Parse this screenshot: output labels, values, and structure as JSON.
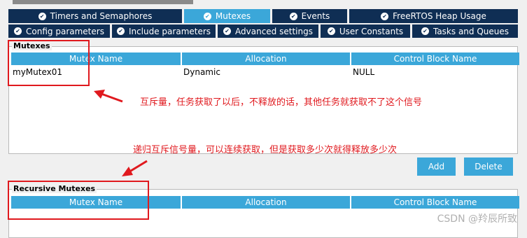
{
  "tabs_row1": [
    {
      "label": "Timers and Semaphores",
      "active": false
    },
    {
      "label": "Mutexes",
      "active": true
    },
    {
      "label": "Events",
      "active": false
    },
    {
      "label": "FreeRTOS Heap Usage",
      "active": false
    }
  ],
  "tabs_row2": [
    {
      "label": "Config parameters"
    },
    {
      "label": "Include parameters"
    },
    {
      "label": "Advanced settings"
    },
    {
      "label": "User Constants"
    },
    {
      "label": "Tasks and Queues"
    }
  ],
  "mutexes": {
    "section_title": "Mutexes",
    "columns": [
      "Mutex Name",
      "Allocation",
      "Control Block Name"
    ],
    "rows": [
      [
        "myMutex01",
        "Dynamic",
        "NULL"
      ]
    ]
  },
  "buttons": {
    "add": "Add",
    "delete": "Delete"
  },
  "recursive_mutexes": {
    "section_title": "Recursive Mutexes",
    "columns": [
      "Mutex Name",
      "Allocation",
      "Control Block Name"
    ]
  },
  "annotations": {
    "note1": "互斥量，任务获取了以后，不释放的话，其他任务就获取不了这个信号",
    "note2": "递归互斥信号量，可以连续获取，但是获取多少次就得释放多少次"
  },
  "watermark": "CSDN @羚辰所致",
  "colors": {
    "tab_dark": "#0f2e54",
    "tab_active": "#3ba7d9",
    "header": "#3ba7d9",
    "annotation_red": "#e0191e"
  }
}
